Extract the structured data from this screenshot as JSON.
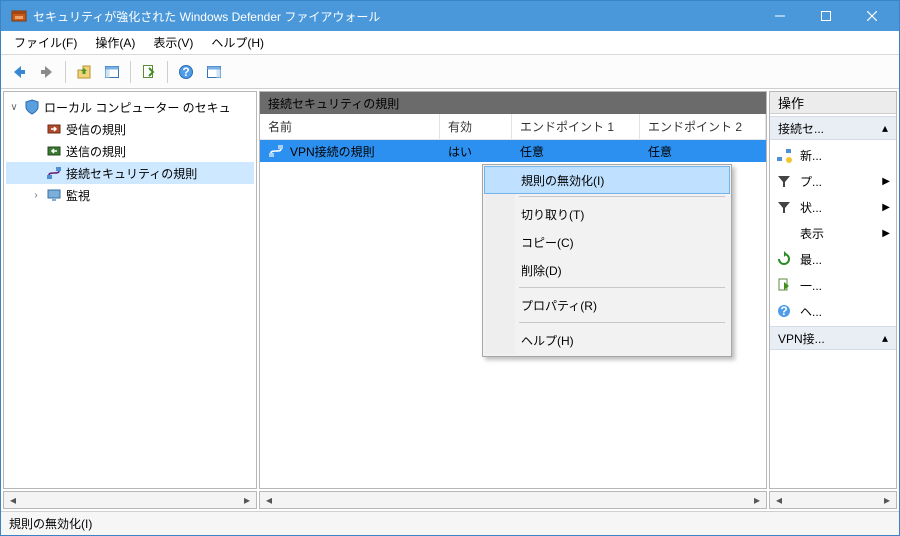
{
  "window": {
    "title": "セキュリティが強化された Windows Defender ファイアウォール"
  },
  "menu": {
    "file": "ファイル(F)",
    "action": "操作(A)",
    "view": "表示(V)",
    "help": "ヘルプ(H)"
  },
  "tree": {
    "root": "ローカル コンピューター のセキュ",
    "inbound": "受信の規則",
    "outbound": "送信の規則",
    "connsec": "接続セキュリティの規則",
    "monitor": "監視"
  },
  "content": {
    "heading": "接続セキュリティの規則",
    "cols": {
      "name": "名前",
      "enabled": "有効",
      "ep1": "エンドポイント 1",
      "ep2": "エンドポイント 2"
    },
    "row": {
      "name": "VPN接続の規則",
      "enabled": "はい",
      "ep1": "任意",
      "ep2": "任意"
    }
  },
  "ctx": {
    "disable": "規則の無効化(I)",
    "cut": "切り取り(T)",
    "copy": "コピー(C)",
    "del": "削除(D)",
    "prop": "プロパティ(R)",
    "help": "ヘルプ(H)"
  },
  "actions": {
    "title": "操作",
    "group1": "接続セ...",
    "new": "新...",
    "prof": "プ...",
    "state": "状...",
    "view": "表示",
    "refresh": "最...",
    "export": "一...",
    "help": "ヘ...",
    "group2": "VPN接..."
  },
  "status": {
    "text": "規則の無効化(I)"
  }
}
